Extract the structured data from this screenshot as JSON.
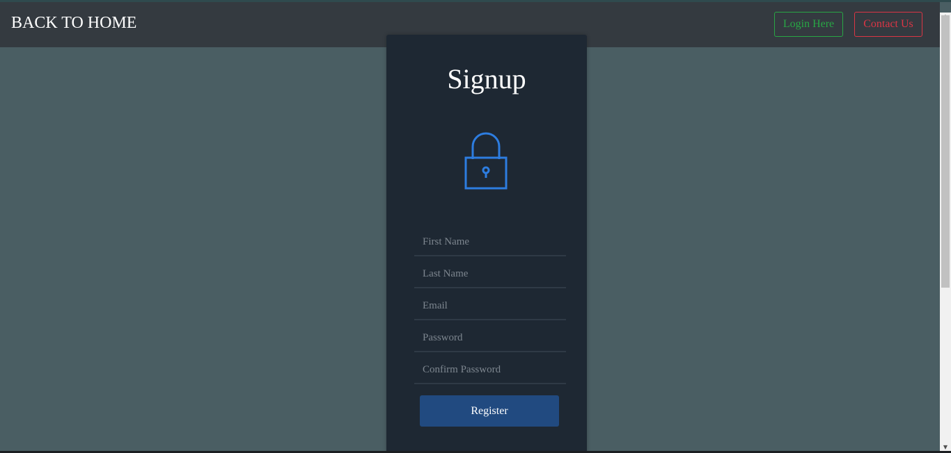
{
  "navbar": {
    "brand": "BACK TO HOME",
    "login_label": "Login Here",
    "contact_label": "Contact Us"
  },
  "signup": {
    "title": "Signup",
    "icon": "lock-icon",
    "fields": {
      "first_name": "First Name",
      "last_name": "Last Name",
      "email": "Email",
      "password": "Password",
      "confirm_password": "Confirm Password"
    },
    "register_label": "Register"
  },
  "colors": {
    "page_bg": "#4a5e63",
    "navbar_bg": "#343a40",
    "card_bg": "#1e2833",
    "login_green": "#28a745",
    "contact_red": "#dc3545",
    "register_blue": "#214a80",
    "lock_blue": "#2d7de0"
  }
}
